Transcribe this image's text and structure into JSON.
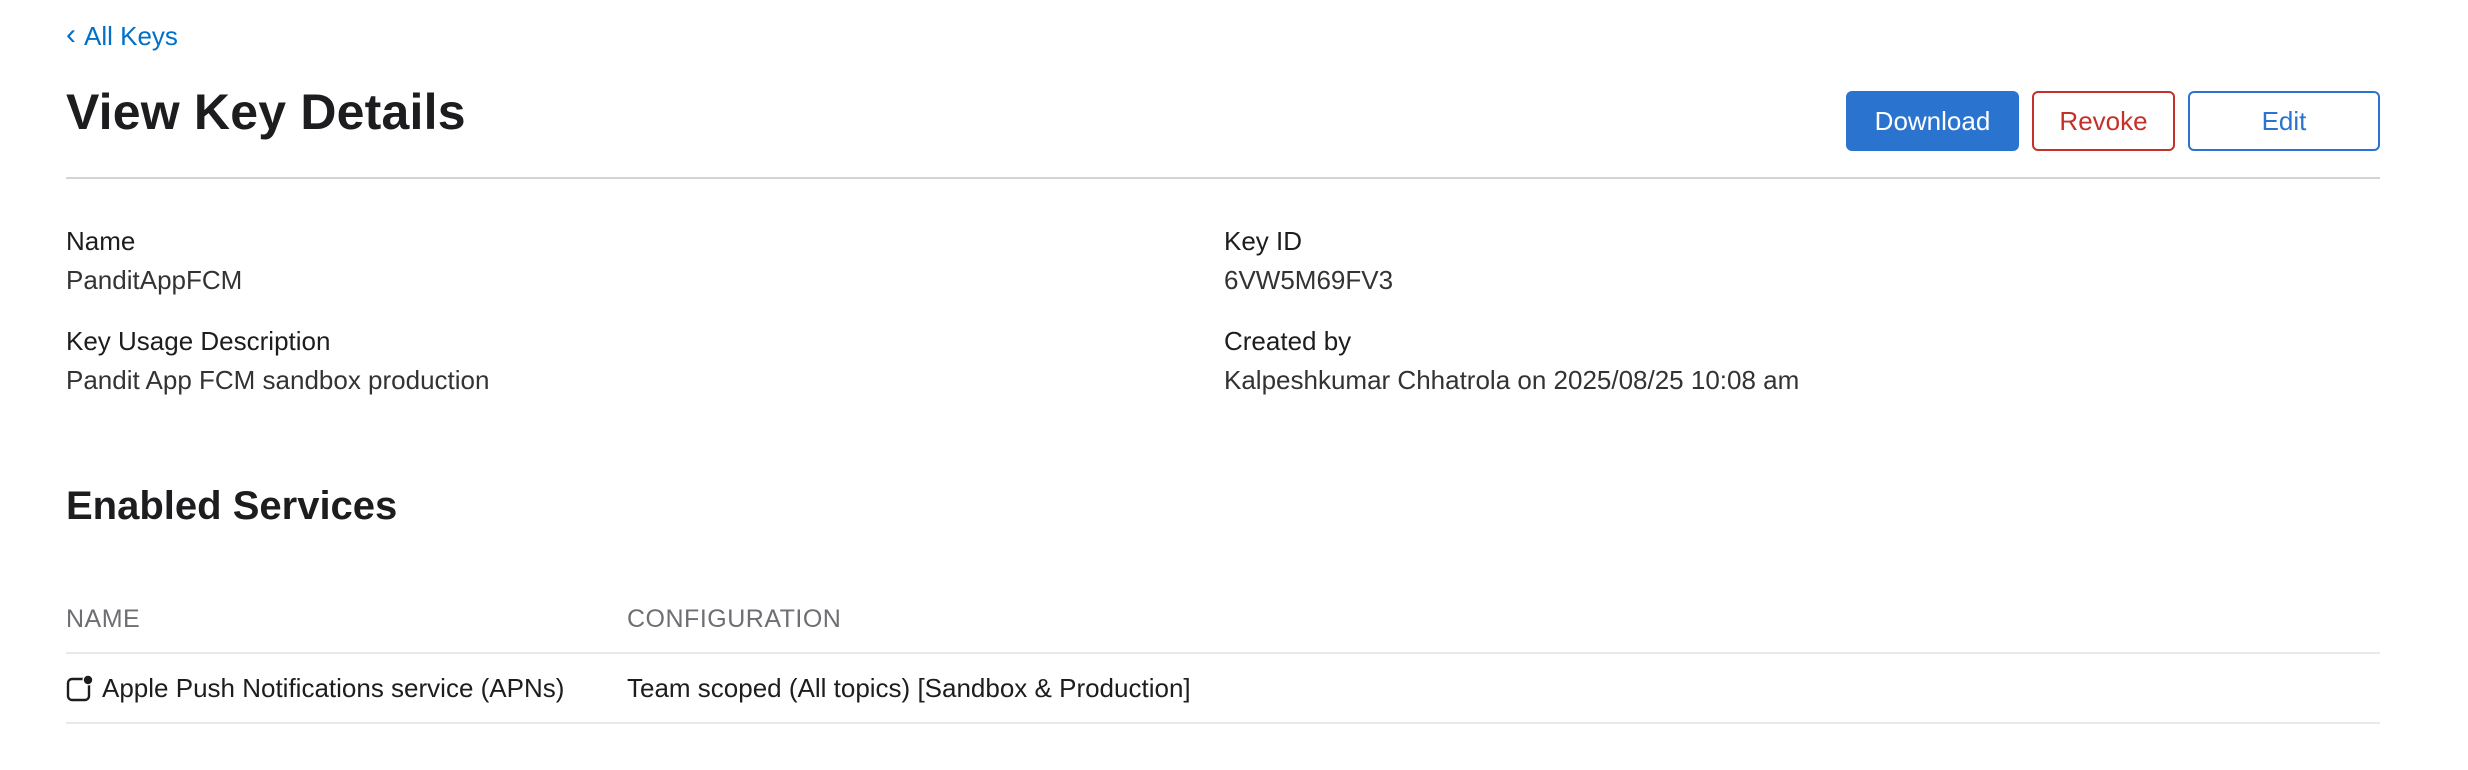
{
  "nav": {
    "back_chevron": "‹",
    "back_label": "All Keys"
  },
  "header": {
    "title": "View Key Details",
    "download_label": "Download",
    "revoke_label": "Revoke",
    "edit_label": "Edit"
  },
  "details": {
    "name_label": "Name",
    "name_value": "PanditAppFCM",
    "key_id_label": "Key ID",
    "key_id_value": "6VW5M69FV3",
    "description_label": "Key Usage Description",
    "description_value": "Pandit App FCM sandbox production",
    "created_by_label": "Created by",
    "created_by_value": "Kalpeshkumar Chhatrola on 2025/08/25 10:08 am"
  },
  "services": {
    "title": "Enabled Services",
    "columns": [
      "NAME",
      "CONFIGURATION"
    ],
    "rows": [
      {
        "icon": "notification-icon",
        "name": "Apple Push Notifications service (APNs)",
        "configuration": "Team scoped (All topics) [Sandbox & Production]"
      }
    ]
  },
  "colors": {
    "accent": "#2a74cf",
    "link": "#0070c9",
    "danger": "#c4312b"
  }
}
